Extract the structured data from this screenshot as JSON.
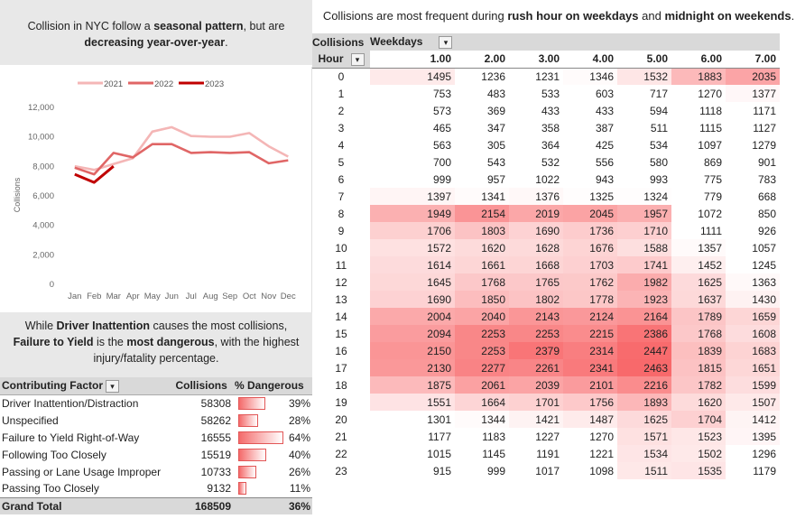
{
  "notes": {
    "top": {
      "t1": "Collision in NYC follow a ",
      "b1": "seasonal pattern",
      "t2": ", but are ",
      "b2": "decreasing year-over-year",
      "t3": "."
    },
    "mid": {
      "b1": "Driver Inattention",
      "t1": " causes the most collisions, ",
      "b2": "Failure to Yield",
      "t2": " is the ",
      "b3": "most dangerous",
      "t3": ", with the highest injury/fatality percentage."
    },
    "heatmap": {
      "t1": "Collisions are most frequent during ",
      "b1": "rush hour on weekdays",
      "t2": " and ",
      "b2": "midnight on weekends",
      "t3": "."
    }
  },
  "chart_data": {
    "type": "line",
    "title": "",
    "xlabel": "",
    "ylabel": "Collisions",
    "categories": [
      "Jan",
      "Feb",
      "Mar",
      "Apr",
      "May",
      "Jun",
      "Jul",
      "Aug",
      "Sep",
      "Oct",
      "Nov",
      "Dec"
    ],
    "ylim": [
      0,
      12000
    ],
    "yticks": [
      "0",
      "2,000",
      "4,000",
      "6,000",
      "8,000",
      "10,000",
      "12,000"
    ],
    "legend_position": "top",
    "series": [
      {
        "name": "2021",
        "color": "#f4b6b6",
        "values": [
          7950,
          7700,
          8100,
          8500,
          10300,
          10600,
          10000,
          9950,
          9950,
          10200,
          9300,
          8600
        ]
      },
      {
        "name": "2022",
        "color": "#e06666",
        "values": [
          7850,
          7400,
          8850,
          8550,
          9450,
          9450,
          8850,
          8900,
          8850,
          8900,
          8150,
          8350
        ]
      },
      {
        "name": "2023",
        "color": "#c00000",
        "values": [
          7400,
          6850,
          7950,
          null,
          null,
          null,
          null,
          null,
          null,
          null,
          null,
          null
        ]
      }
    ]
  },
  "factors": {
    "header": {
      "factor": "Contributing Factor",
      "collisions": "Collisions",
      "dangerous": "% Dangerous"
    },
    "filter_icon": "sort-filter-icon",
    "rows": [
      {
        "factor": "Driver Inattention/Distraction",
        "collisions": "58308",
        "pct": "39%",
        "ratio": 0.39
      },
      {
        "factor": "Unspecified",
        "collisions": "58262",
        "pct": "28%",
        "ratio": 0.28
      },
      {
        "factor": "Failure to Yield Right-of-Way",
        "collisions": "16555",
        "pct": "64%",
        "ratio": 0.64
      },
      {
        "factor": "Following Too Closely",
        "collisions": "15519",
        "pct": "40%",
        "ratio": 0.4
      },
      {
        "factor": "Passing or Lane Usage Improper",
        "collisions": "10733",
        "pct": "26%",
        "ratio": 0.26
      },
      {
        "factor": "Passing Too Closely",
        "collisions": "9132",
        "pct": "11%",
        "ratio": 0.11
      }
    ],
    "total": {
      "label": "Grand Total",
      "collisions": "168509",
      "pct": "36%"
    },
    "bar_color": "#f46a6a"
  },
  "heatmap": {
    "corner": "Collisions",
    "cols_label": "Weekdays",
    "rows_label": "Hour",
    "dropdown_icon": "chevron-down-icon",
    "columns": [
      "1.00",
      "2.00",
      "3.00",
      "4.00",
      "5.00",
      "6.00",
      "7.00"
    ],
    "scale_color": "#f8696b",
    "rows": [
      {
        "hour": "0",
        "values": [
          1495,
          1236,
          1231,
          1346,
          1532,
          1883,
          2035
        ]
      },
      {
        "hour": "1",
        "values": [
          753,
          483,
          533,
          603,
          717,
          1270,
          1377
        ]
      },
      {
        "hour": "2",
        "values": [
          573,
          369,
          433,
          433,
          594,
          1118,
          1171
        ]
      },
      {
        "hour": "3",
        "values": [
          465,
          347,
          358,
          387,
          511,
          1115,
          1127
        ]
      },
      {
        "hour": "4",
        "values": [
          563,
          305,
          364,
          425,
          534,
          1097,
          1279
        ]
      },
      {
        "hour": "5",
        "values": [
          700,
          543,
          532,
          556,
          580,
          869,
          901
        ]
      },
      {
        "hour": "6",
        "values": [
          999,
          957,
          1022,
          943,
          993,
          775,
          783
        ]
      },
      {
        "hour": "7",
        "values": [
          1397,
          1341,
          1376,
          1325,
          1324,
          779,
          668
        ]
      },
      {
        "hour": "8",
        "values": [
          1949,
          2154,
          2019,
          2045,
          1957,
          1072,
          850
        ]
      },
      {
        "hour": "9",
        "values": [
          1706,
          1803,
          1690,
          1736,
          1710,
          1111,
          926
        ]
      },
      {
        "hour": "10",
        "values": [
          1572,
          1620,
          1628,
          1676,
          1588,
          1357,
          1057
        ]
      },
      {
        "hour": "11",
        "values": [
          1614,
          1661,
          1668,
          1703,
          1741,
          1452,
          1245
        ]
      },
      {
        "hour": "12",
        "values": [
          1645,
          1768,
          1765,
          1762,
          1982,
          1625,
          1363
        ]
      },
      {
        "hour": "13",
        "values": [
          1690,
          1850,
          1802,
          1778,
          1923,
          1637,
          1430
        ]
      },
      {
        "hour": "14",
        "values": [
          2004,
          2040,
          2143,
          2124,
          2164,
          1789,
          1659
        ]
      },
      {
        "hour": "15",
        "values": [
          2094,
          2253,
          2253,
          2215,
          2386,
          1768,
          1608
        ]
      },
      {
        "hour": "16",
        "values": [
          2150,
          2253,
          2379,
          2314,
          2447,
          1839,
          1683
        ]
      },
      {
        "hour": "17",
        "values": [
          2130,
          2277,
          2261,
          2341,
          2463,
          1815,
          1651
        ]
      },
      {
        "hour": "18",
        "values": [
          1875,
          2061,
          2039,
          2101,
          2216,
          1782,
          1599
        ]
      },
      {
        "hour": "19",
        "values": [
          1551,
          1664,
          1701,
          1756,
          1893,
          1620,
          1507
        ]
      },
      {
        "hour": "20",
        "values": [
          1301,
          1344,
          1421,
          1487,
          1625,
          1704,
          1412
        ]
      },
      {
        "hour": "21",
        "values": [
          1177,
          1183,
          1227,
          1270,
          1571,
          1523,
          1395
        ]
      },
      {
        "hour": "22",
        "values": [
          1015,
          1145,
          1191,
          1221,
          1534,
          1502,
          1296
        ]
      },
      {
        "hour": "23",
        "values": [
          915,
          999,
          1017,
          1098,
          1511,
          1535,
          1179
        ]
      }
    ]
  }
}
